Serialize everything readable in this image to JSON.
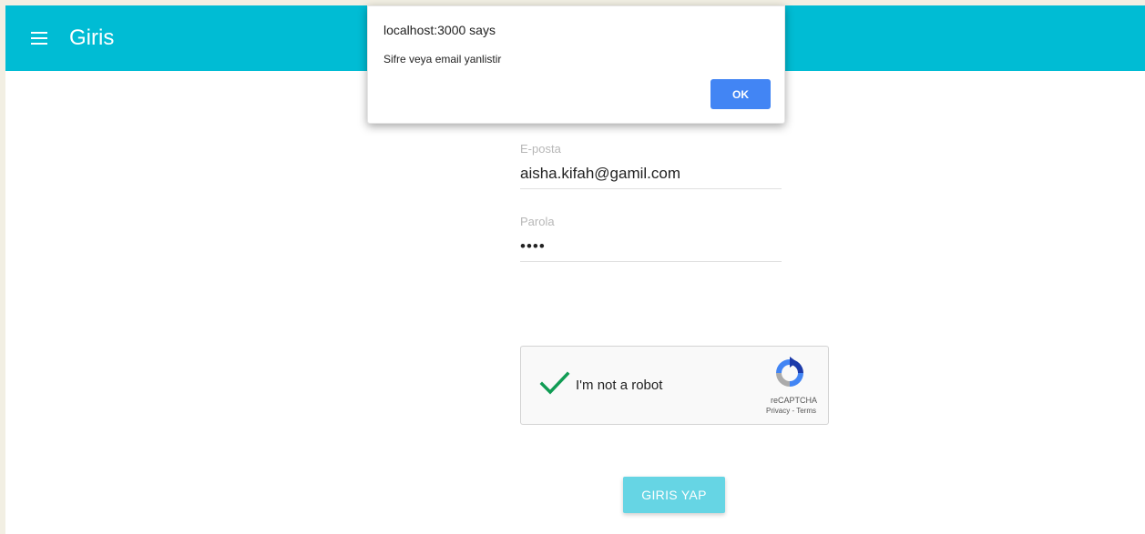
{
  "appbar": {
    "title": "Giris"
  },
  "form": {
    "email": {
      "label": "E-posta",
      "value": "aisha.kifah@gamil.com"
    },
    "password": {
      "label": "Parola",
      "masked_value": "••••"
    }
  },
  "captcha": {
    "label": "I'm not a robot",
    "brand": "reCAPTCHA",
    "links": "Privacy - Terms",
    "checked": true
  },
  "submit": {
    "label": "GIRIS YAP"
  },
  "dialog": {
    "title": "localhost:3000 says",
    "message": "Sifre veya email yanlistir",
    "ok_label": "OK"
  },
  "colors": {
    "appbar": "#00bcd4",
    "submit": "#66d5e4",
    "dialog_ok": "#4285f4",
    "check": "#109c54"
  }
}
